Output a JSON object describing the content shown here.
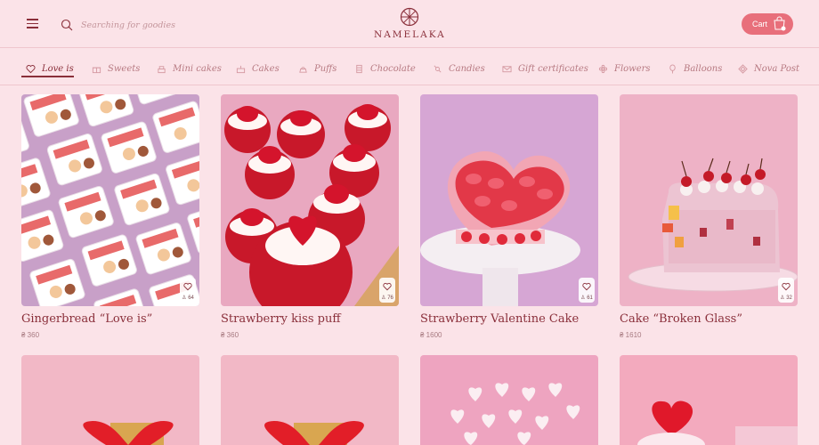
{
  "header": {
    "search_placeholder": "Searching for goodies",
    "logo_text": "NAMELAKA",
    "cart_label": "Cart"
  },
  "nav": {
    "items": [
      {
        "label": "Love is",
        "icon": "heart-icon",
        "active": true
      },
      {
        "label": "Sweets",
        "icon": "gift-box-icon"
      },
      {
        "label": "Mini cakes",
        "icon": "mini-cake-icon"
      },
      {
        "label": "Cakes",
        "icon": "cake-icon"
      },
      {
        "label": "Puffs",
        "icon": "puff-icon"
      },
      {
        "label": "Chocolate",
        "icon": "chocolate-icon"
      },
      {
        "label": "Candies",
        "icon": "candy-icon"
      },
      {
        "label": "Gift certificates",
        "icon": "certificate-icon"
      },
      {
        "label": "Flowers",
        "icon": "flower-icon"
      },
      {
        "label": "Balloons",
        "icon": "balloon-icon"
      },
      {
        "label": "Nova Post",
        "icon": "nova-post-icon"
      }
    ]
  },
  "products": [
    {
      "title": "Gingerbread “Love is”",
      "price": "₴ 360",
      "likes": "64"
    },
    {
      "title": "Strawberry kiss puff",
      "price": "₴ 360",
      "likes": "76"
    },
    {
      "title": "Strawberry Valentine Cake",
      "price": "₴ 1600",
      "likes": "61"
    },
    {
      "title": "Cake “Broken Glass”",
      "price": "₴ 1610",
      "likes": "32"
    }
  ],
  "colors": {
    "background": "#fbe3e8",
    "accent": "#e86f7b",
    "text": "#8a2f3a"
  }
}
